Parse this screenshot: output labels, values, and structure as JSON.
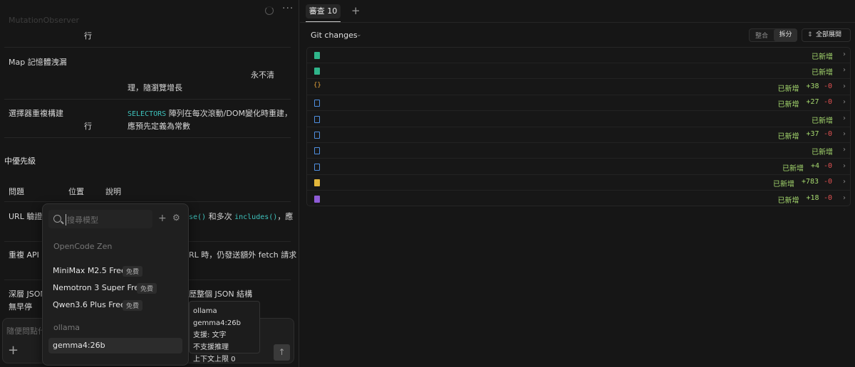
{
  "left": {
    "top_fragment": "MutationObserver",
    "row1_cont": "行",
    "row2_issue": "Map 記憶體洩漏",
    "row2_desc_a": "永不清",
    "row2_desc_b": "理，隨瀏覽增長",
    "row3_issue": "選擇器重複構建",
    "row3_cont": "行",
    "row3_code": "SELECTORS",
    "row3_desc_a": "陣列在每次滾動/DOM變化時重建，",
    "row3_desc_b": "應預先定義為常數",
    "section_heading": "中優先級",
    "col_issue": "問題",
    "col_location": "位置",
    "col_desc": "說明",
    "r4_issue": "URL 驗證低",
    "r4_code1": "se()",
    "r4_mid": "和多次",
    "r4_code2": "includes()",
    "r4_tail": "，應",
    "r5_issue": "重複 API 呼",
    "r5_tail": "RL 時，仍發送額外 fetch 請求",
    "r6_issue": "深層 JSON",
    "r6_tail": "歷整個 JSON 結構",
    "r6_cont": "無早停"
  },
  "popup": {
    "search_placeholder": "搜尋模型",
    "group1": "OpenCode Zen",
    "models": [
      {
        "name": "MiniMax M2.5 Free",
        "tag": "免費"
      },
      {
        "name": "Nemotron 3 Super Free",
        "tag": "免費"
      },
      {
        "name": "Qwen3.6 Plus Free",
        "tag": "免費"
      }
    ],
    "group2": "ollama",
    "selected_model": "gemma4:26b"
  },
  "tooltip": {
    "line1": "ollama gemma4:26b",
    "line2": "支援: 文字",
    "line3": "不支援推理",
    "line4": "上下文上限 0"
  },
  "prompt": {
    "placeholder": "隨便問點什",
    "add_icon": "+",
    "send_icon": "↑"
  },
  "right": {
    "tab_label": "審查 10",
    "tab_add": "+",
    "git_title": "Git changes",
    "seg_unified": "整合",
    "seg_split": "拆分",
    "expand_all": "全部展開",
    "files": [
      {
        "icon": "image",
        "status": "已新增",
        "plus": "",
        "minus": ""
      },
      {
        "icon": "image",
        "status": "已新增",
        "plus": "",
        "minus": ""
      },
      {
        "icon": "json",
        "status": "已新增",
        "plus": "+38",
        "minus": "-0"
      },
      {
        "icon": "doc",
        "status": "已新增",
        "plus": "+27",
        "minus": "-0"
      },
      {
        "icon": "doc",
        "status": "已新增",
        "plus": "",
        "minus": ""
      },
      {
        "icon": "doc",
        "status": "已新增",
        "plus": "+37",
        "minus": "-0"
      },
      {
        "icon": "doc",
        "status": "已新增",
        "plus": "",
        "minus": ""
      },
      {
        "icon": "doc",
        "status": "已新增",
        "plus": "+4",
        "minus": "-0"
      },
      {
        "icon": "js",
        "status": "已新增",
        "plus": "+783",
        "minus": "-0"
      },
      {
        "icon": "image2",
        "status": "已新增",
        "plus": "+18",
        "minus": "-0"
      }
    ]
  },
  "colors": {
    "added_green": "#a5d86e",
    "removed_red": "#e35252",
    "code_teal": "#3ec3bd"
  }
}
